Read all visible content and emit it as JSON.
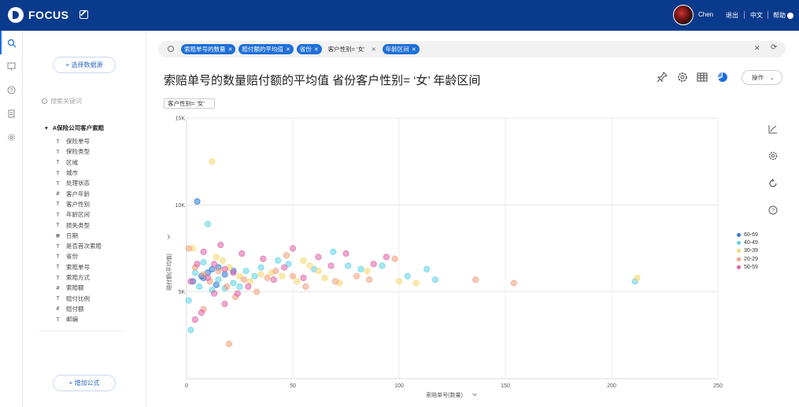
{
  "app": {
    "logo_text": "FOCUS",
    "user_name": "Chen",
    "logout": "退出",
    "language": "中文",
    "help": "帮助"
  },
  "sidebar": {
    "select_source": "+ 选择数据源",
    "search_placeholder": "搜索关键词",
    "root": "A保险公司客户索赔",
    "fields": [
      {
        "label": "保险单号",
        "icon": "T"
      },
      {
        "label": "保险类型",
        "icon": "T"
      },
      {
        "label": "区域",
        "icon": "T"
      },
      {
        "label": "城市",
        "icon": "T"
      },
      {
        "label": "处理状态",
        "icon": "T"
      },
      {
        "label": "客户年龄",
        "icon": "#"
      },
      {
        "label": "客户性别",
        "icon": "T"
      },
      {
        "label": "年龄区间",
        "icon": "T"
      },
      {
        "label": "损失类型",
        "icon": "T"
      },
      {
        "label": "日期",
        "icon": "▦"
      },
      {
        "label": "是否首次索赔",
        "icon": "T"
      },
      {
        "label": "省份",
        "icon": "T"
      },
      {
        "label": "索赔单号",
        "icon": "T"
      },
      {
        "label": "索赔方式",
        "icon": "T"
      },
      {
        "label": "索赔额",
        "icon": "#"
      },
      {
        "label": "赔付比例",
        "icon": "T"
      },
      {
        "label": "赔付额",
        "icon": "#"
      },
      {
        "label": "邮编",
        "icon": "T"
      }
    ],
    "add_formula": "+ 增加公式"
  },
  "query": {
    "chips": [
      "索赔单号的数量",
      "赔付额的平均值",
      "省份"
    ],
    "plain": "客户性别= '女'",
    "chip_last": "年龄区间"
  },
  "main": {
    "title": "索赔单号的数量赔付额的平均值 省份客户性别= ‘女’ 年龄区间",
    "ops_button": "操作",
    "filter_tag": "客户性别= '女'"
  },
  "chart_data": {
    "type": "scatter",
    "xlabel": "索赔单号(数量)",
    "ylabel": "赔付额(平均值)",
    "xlim": [
      0,
      250
    ],
    "ylim": [
      0,
      15000
    ],
    "x_ticks": [
      "0",
      "50",
      "100",
      "150",
      "200",
      "250"
    ],
    "y_ticks": [
      "5K",
      "10K",
      "15K"
    ],
    "grid": true,
    "legend_position": "right",
    "series": [
      {
        "name": "60-69",
        "color": "#2e7bd6",
        "points": [
          [
            5,
            10200
          ],
          [
            3,
            5600
          ],
          [
            7,
            5900
          ],
          [
            10,
            6100
          ],
          [
            12,
            6300
          ],
          [
            15,
            6400
          ],
          [
            18,
            6000
          ],
          [
            14,
            5400
          ],
          [
            22,
            6200
          ],
          [
            8,
            5800
          ]
        ]
      },
      {
        "name": "40-49",
        "color": "#5fd3e6",
        "points": [
          [
            10,
            8900
          ],
          [
            1,
            4500
          ],
          [
            4,
            6100
          ],
          [
            6,
            5300
          ],
          [
            8,
            6700
          ],
          [
            12,
            5100
          ],
          [
            15,
            5700
          ],
          [
            18,
            5200
          ],
          [
            22,
            5500
          ],
          [
            25,
            5300
          ],
          [
            28,
            6200
          ],
          [
            32,
            5900
          ],
          [
            35,
            6400
          ],
          [
            43,
            6800
          ],
          [
            48,
            6600
          ],
          [
            60,
            6300
          ],
          [
            69,
            7300
          ],
          [
            76,
            6500
          ],
          [
            82,
            6300
          ],
          [
            92,
            6500
          ],
          [
            104,
            5900
          ],
          [
            113,
            6300
          ],
          [
            117,
            5700
          ],
          [
            211,
            5600
          ],
          [
            2,
            2800
          ]
        ]
      },
      {
        "name": "30-39",
        "color": "#f5d76e",
        "points": [
          [
            12,
            12500
          ],
          [
            3,
            7500
          ],
          [
            14,
            7000
          ],
          [
            17,
            6800
          ],
          [
            20,
            6400
          ],
          [
            25,
            5900
          ],
          [
            30,
            5600
          ],
          [
            35,
            6000
          ],
          [
            40,
            6100
          ],
          [
            45,
            5900
          ],
          [
            52,
            5600
          ],
          [
            58,
            6500
          ],
          [
            65,
            5800
          ],
          [
            72,
            5500
          ],
          [
            85,
            6200
          ],
          [
            100,
            5600
          ],
          [
            108,
            5500
          ],
          [
            212,
            5800
          ],
          [
            55,
            6800
          ],
          [
            62,
            6200
          ]
        ]
      },
      {
        "name": "20-29",
        "color": "#f2a07b",
        "points": [
          [
            1,
            7500
          ],
          [
            4,
            6400
          ],
          [
            8,
            6000
          ],
          [
            11,
            5600
          ],
          [
            15,
            6200
          ],
          [
            19,
            5300
          ],
          [
            23,
            4700
          ],
          [
            27,
            5700
          ],
          [
            33,
            5000
          ],
          [
            38,
            5800
          ],
          [
            42,
            6200
          ],
          [
            47,
            7100
          ],
          [
            50,
            5900
          ],
          [
            56,
            5300
          ],
          [
            70,
            5600
          ],
          [
            80,
            5900
          ],
          [
            86,
            5700
          ],
          [
            98,
            6900
          ],
          [
            136,
            5700
          ],
          [
            154,
            5500
          ],
          [
            20,
            2000
          ],
          [
            8,
            4000
          ]
        ]
      },
      {
        "name": "50-59",
        "color": "#e062a8",
        "points": [
          [
            2,
            5600
          ],
          [
            5,
            6600
          ],
          [
            8,
            7300
          ],
          [
            10,
            5800
          ],
          [
            13,
            6600
          ],
          [
            16,
            7700
          ],
          [
            18,
            6300
          ],
          [
            22,
            6100
          ],
          [
            26,
            7200
          ],
          [
            29,
            5300
          ],
          [
            36,
            6900
          ],
          [
            41,
            5700
          ],
          [
            46,
            6400
          ],
          [
            50,
            7500
          ],
          [
            55,
            5800
          ],
          [
            62,
            7000
          ],
          [
            68,
            6500
          ],
          [
            75,
            7200
          ],
          [
            88,
            6600
          ],
          [
            94,
            7000
          ],
          [
            13,
            4900
          ],
          [
            18,
            4300
          ],
          [
            24,
            4900
          ],
          [
            4,
            3400
          ],
          [
            7,
            3800
          ]
        ]
      }
    ]
  }
}
